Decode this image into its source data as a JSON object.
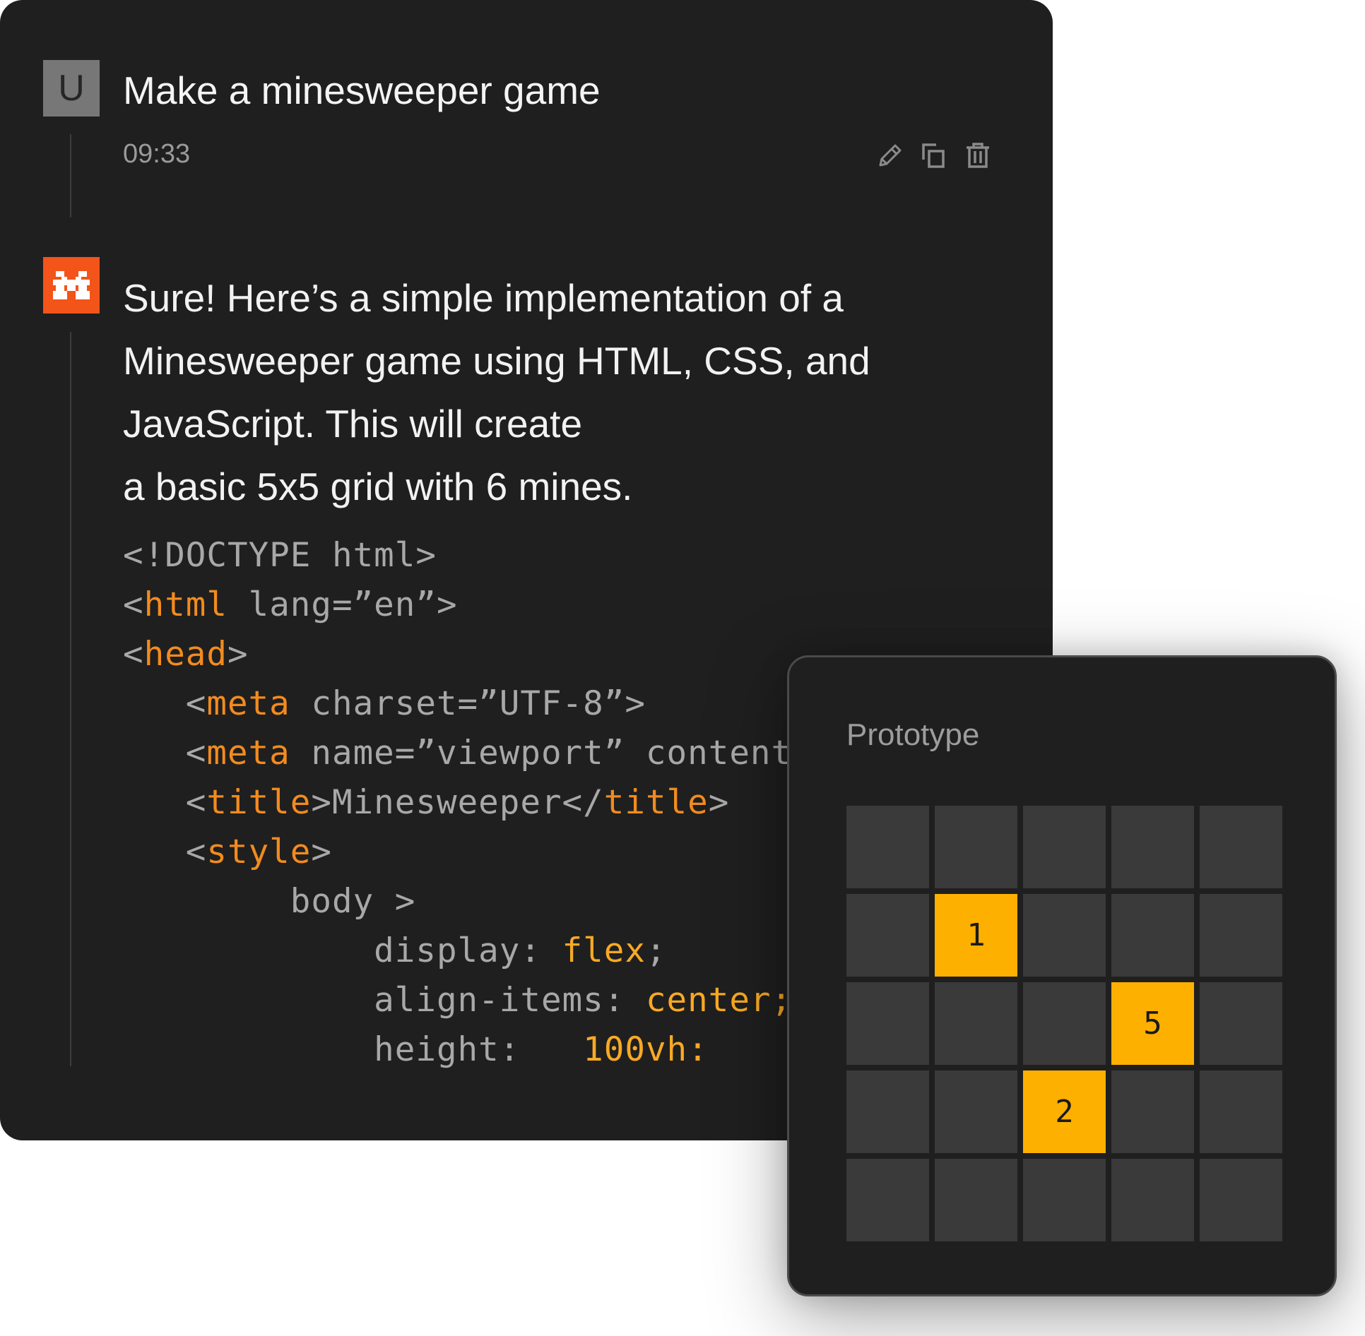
{
  "user_message": {
    "avatar_letter": "U",
    "text": "Make a minesweeper game",
    "time": "09:33",
    "actions": [
      "edit-icon",
      "copy-icon",
      "delete-icon"
    ]
  },
  "assistant_message": {
    "avatar": "brand-logo-icon",
    "lines": [
      "Sure! Here’s a simple implementation of a",
      "Minesweeper game using HTML, CSS, and",
      "JavaScript. This will create",
      "a basic 5x5 grid with 6 mines."
    ],
    "code_lines": [
      [
        {
          "t": "<!DOCTYPE html>",
          "c": "plain"
        }
      ],
      [
        {
          "t": "<",
          "c": "plain"
        },
        {
          "t": "html",
          "c": "tag"
        },
        {
          "t": " lang=”en”>",
          "c": "plain"
        }
      ],
      [
        {
          "t": "<",
          "c": "plain"
        },
        {
          "t": "head",
          "c": "tag"
        },
        {
          "t": ">",
          "c": "plain"
        }
      ],
      [
        {
          "t": "   <",
          "c": "plain"
        },
        {
          "t": "meta",
          "c": "tag"
        },
        {
          "t": " charset=”UTF-8”>",
          "c": "plain"
        }
      ],
      [
        {
          "t": "   <",
          "c": "plain"
        },
        {
          "t": "meta",
          "c": "tag"
        },
        {
          "t": " name=”viewport” content",
          "c": "plain"
        }
      ],
      [
        {
          "t": "   <",
          "c": "plain"
        },
        {
          "t": "title",
          "c": "tag"
        },
        {
          "t": ">Minesweeper</",
          "c": "plain"
        },
        {
          "t": "title",
          "c": "tag"
        },
        {
          "t": ">",
          "c": "plain"
        }
      ],
      [
        {
          "t": "   <",
          "c": "plain"
        },
        {
          "t": "style",
          "c": "tag"
        },
        {
          "t": ">",
          "c": "plain"
        }
      ],
      [
        {
          "t": "        body >",
          "c": "plain"
        }
      ],
      [
        {
          "t": "            display: ",
          "c": "plain"
        },
        {
          "t": "flex",
          "c": "val"
        },
        {
          "t": ";",
          "c": "plain"
        }
      ],
      [
        {
          "t": "            align-items: ",
          "c": "plain"
        },
        {
          "t": "center;",
          "c": "val"
        }
      ],
      [
        {
          "t": "            height:   ",
          "c": "plain"
        },
        {
          "t": "100vh:",
          "c": "val"
        }
      ]
    ]
  },
  "prototype": {
    "title": "Prototype",
    "grid": [
      [
        "",
        "",
        "",
        "",
        ""
      ],
      [
        "",
        "1",
        "",
        "",
        ""
      ],
      [
        "",
        "",
        "",
        "5",
        ""
      ],
      [
        "",
        "",
        "2",
        "",
        ""
      ],
      [
        "",
        "",
        "",
        "",
        ""
      ]
    ],
    "colors": {
      "hidden": "#3a3a3a",
      "revealed": "#fdb000",
      "accent": "#f2541a"
    }
  }
}
